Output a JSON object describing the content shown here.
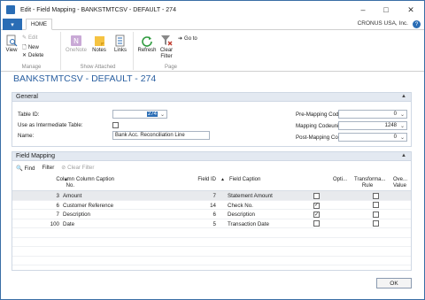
{
  "window": {
    "title": "Edit - Field Mapping - BANKSTMTCSV - DEFAULT - 274",
    "minimize": "–",
    "maximize": "□",
    "close": "✕"
  },
  "ribbon_tabs": {
    "menu_glyph": "▾",
    "home": "HOME",
    "company": "CRONUS USA, Inc.",
    "help": "?"
  },
  "ribbon": {
    "manage": {
      "label": "Manage",
      "view": "View",
      "edit": "Edit",
      "new": "New",
      "delete": "Delete"
    },
    "show_attached": {
      "label": "Show Attached",
      "onenote": "OneNote",
      "notes": "Notes",
      "links": "Links"
    },
    "page": {
      "label": "Page",
      "refresh": "Refresh",
      "clear_filter": "Clear Filter",
      "goto": "Go to"
    }
  },
  "page_header": "BANKSTMTCSV - DEFAULT - 274",
  "general": {
    "title": "General",
    "table_id_label": "Table ID:",
    "table_id_value": "274",
    "use_intermediate_label": "Use as Intermediate Table:",
    "use_intermediate_checked": false,
    "name_label": "Name:",
    "name_value": "Bank Acc. Reconciliation Line",
    "pre_mapping_label": "Pre-Mapping Codeunit:",
    "pre_mapping_value": "0",
    "mapping_label": "Mapping Codeunit:",
    "mapping_value": "1248",
    "post_mapping_label": "Post-Mapping Codeunit:",
    "post_mapping_value": "0"
  },
  "field_mapping": {
    "title": "Field Mapping",
    "toolbar": {
      "find": "Find",
      "filter": "Filter",
      "clear_filter": "Clear Filter"
    },
    "columns": {
      "column_no_1": "Column",
      "column_no_2": "No.",
      "column_caption": "Column Caption",
      "field_id": "Field ID",
      "field_caption": "Field Caption",
      "optional": "Opti...",
      "transformation_1": "Transforma...",
      "transformation_2": "Rule",
      "overwrite_1": "Ove...",
      "overwrite_2": "Value"
    },
    "rows": [
      {
        "column_no": "3",
        "column_caption": "Amount",
        "field_id": "7",
        "field_caption": "Statement Amount",
        "optional": false,
        "overwrite": false
      },
      {
        "column_no": "6",
        "column_caption": "Customer Reference",
        "field_id": "14",
        "field_caption": "Check No.",
        "optional": true,
        "overwrite": false
      },
      {
        "column_no": "7",
        "column_caption": "Description",
        "field_id": "6",
        "field_caption": "Description",
        "optional": true,
        "overwrite": false
      },
      {
        "column_no": "100",
        "column_caption": "Date",
        "field_id": "5",
        "field_caption": "Transaction Date",
        "optional": false,
        "overwrite": false
      }
    ]
  },
  "ok_button": "OK"
}
